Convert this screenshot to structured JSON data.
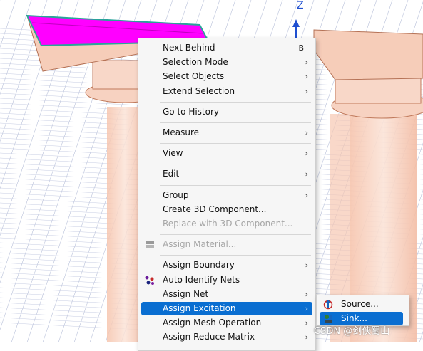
{
  "viewport": {
    "axis_label": "Z"
  },
  "context_menu": {
    "items": [
      {
        "label": "Next Behind",
        "shortcut": "B",
        "submenu": false,
        "disabled": false
      },
      {
        "label": "Selection Mode",
        "submenu": true,
        "disabled": false
      },
      {
        "label": "Select Objects",
        "submenu": true,
        "disabled": false
      },
      {
        "label": "Extend Selection",
        "submenu": true,
        "disabled": false
      },
      {
        "label": "Go to History",
        "submenu": false,
        "disabled": false
      },
      {
        "label": "Measure",
        "submenu": true,
        "disabled": false
      },
      {
        "label": "View",
        "submenu": true,
        "disabled": false
      },
      {
        "label": "Edit",
        "submenu": true,
        "disabled": false
      },
      {
        "label": "Group",
        "submenu": true,
        "disabled": false
      },
      {
        "label": "Create 3D Component...",
        "submenu": false,
        "disabled": false
      },
      {
        "label": "Replace with 3D Component...",
        "submenu": false,
        "disabled": true
      },
      {
        "label": "Assign Material...",
        "submenu": false,
        "disabled": true,
        "icon": "material-icon"
      },
      {
        "label": "Assign Boundary",
        "submenu": true,
        "disabled": false
      },
      {
        "label": "Auto Identify Nets",
        "submenu": false,
        "disabled": false,
        "icon": "nets-icon"
      },
      {
        "label": "Assign Net",
        "submenu": true,
        "disabled": false
      },
      {
        "label": "Assign Excitation",
        "submenu": true,
        "disabled": false,
        "highlighted": true
      },
      {
        "label": "Assign Mesh Operation",
        "submenu": true,
        "disabled": false
      },
      {
        "label": "Assign Reduce Matrix",
        "submenu": true,
        "disabled": false
      }
    ]
  },
  "submenu": {
    "items": [
      {
        "label": "Source...",
        "icon": "source-icon",
        "highlighted": false
      },
      {
        "label": "Sink...",
        "icon": "sink-icon",
        "highlighted": true
      }
    ]
  },
  "watermark": "CSDN @剑侠蜀山",
  "colors": {
    "highlight": "#0a6ed1",
    "selected_face": "#ff00ff",
    "model": "#f4c9b4",
    "grid": "#9aa6c8"
  }
}
